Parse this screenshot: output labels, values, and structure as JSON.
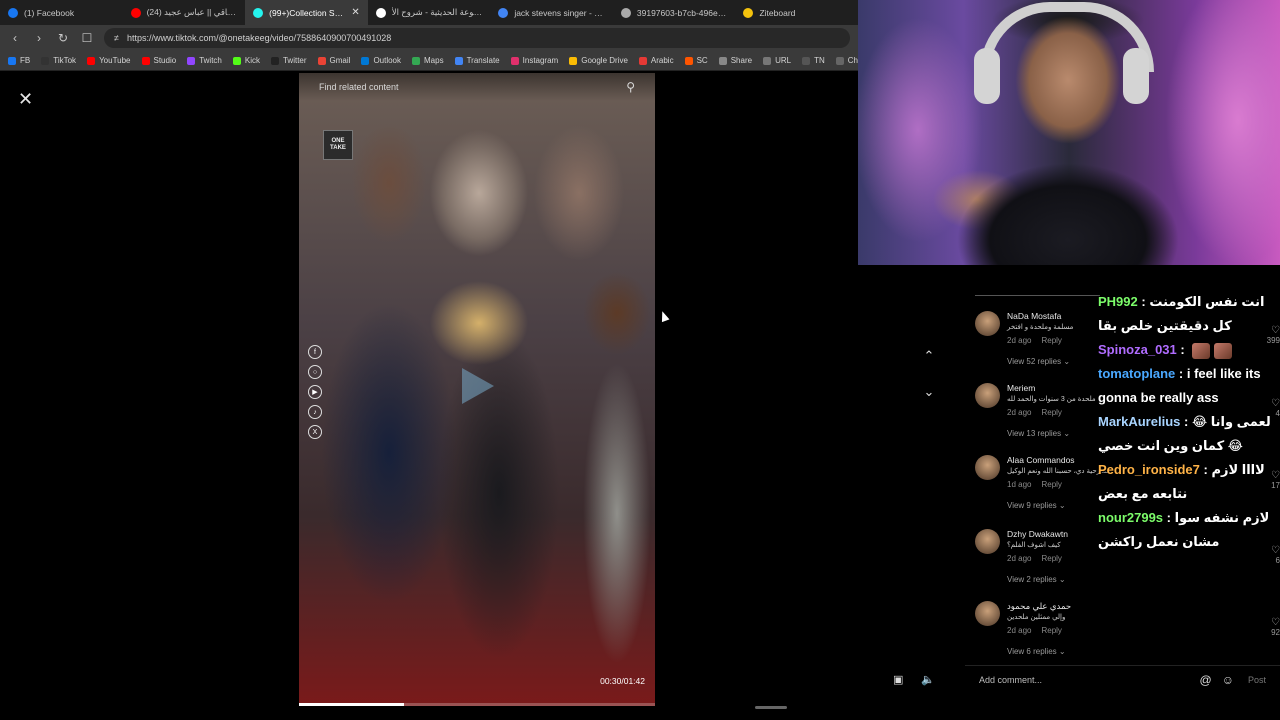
{
  "browser": {
    "tabs": [
      {
        "title": "(1) Facebook",
        "color": "#1877f2",
        "active": false
      },
      {
        "title": "(24) اجمل ساقي || عباس عجيد",
        "color": "#ff0000",
        "active": false
      },
      {
        "title": "(99+)Collection Stream",
        "color": "#25f4ee",
        "active": true
      },
      {
        "title": "الموسوعة الحديثية - شروح الأ",
        "color": "#ffffff",
        "active": false
      },
      {
        "title": "jack stevens singer - Google",
        "color": "#4285f4",
        "active": false
      },
      {
        "title": "39197603-b7cb-496e-8b98-",
        "color": "#aaaaaa",
        "active": false
      },
      {
        "title": "Ziteboard",
        "color": "#f4c20d",
        "active": false
      }
    ],
    "url": "https://www.tiktok.com/@onetakeeg/video/7588640900700491028",
    "bookmarks": [
      {
        "label": "FB",
        "color": "#1877f2"
      },
      {
        "label": "TikTok",
        "color": "#333333"
      },
      {
        "label": "YouTube",
        "color": "#ff0000"
      },
      {
        "label": "Studio",
        "color": "#ff0000"
      },
      {
        "label": "Twitch",
        "color": "#9146ff"
      },
      {
        "label": "Kick",
        "color": "#53fc18"
      },
      {
        "label": "Twitter",
        "color": "#222222"
      },
      {
        "label": "Gmail",
        "color": "#ea4335"
      },
      {
        "label": "Outlook",
        "color": "#0078d4"
      },
      {
        "label": "Maps",
        "color": "#34a853"
      },
      {
        "label": "Translate",
        "color": "#4285f4"
      },
      {
        "label": "Instagram",
        "color": "#e1306c"
      },
      {
        "label": "Google Drive",
        "color": "#fbbc04"
      },
      {
        "label": "Arabic",
        "color": "#e53935"
      },
      {
        "label": "SC",
        "color": "#ff5500"
      },
      {
        "label": "Share",
        "color": "#888888"
      },
      {
        "label": "URL",
        "color": "#777777"
      },
      {
        "label": "TN",
        "color": "#555555"
      },
      {
        "label": "Ch",
        "color": "#666666"
      }
    ]
  },
  "video": {
    "search_placeholder": "Find related content",
    "badge_text": "ONE TAKE",
    "timecode": "00:30/01:42",
    "progress_fraction": 0.294
  },
  "comments": [
    {
      "name": "NaDa Mostafa",
      "text": "مسلمة وملحدة و افتخر",
      "age": "2d ago",
      "reply": "Reply",
      "replies": "View 52 replies"
    },
    {
      "name": "Meriem",
      "text": "ملحدة من 3 سنوات والحمد لله",
      "age": "2d ago",
      "reply": "Reply",
      "replies": "View 13 replies"
    },
    {
      "name": "Alaa Commandos",
      "text": "مسرحية دي، حسبنا الله ونعم الوكيل",
      "age": "1d ago",
      "reply": "Reply",
      "replies": "View 9 replies"
    },
    {
      "name": "Dzhy Dwakawtn",
      "text": "كيف اشوف الفلم؟",
      "age": "2d ago",
      "reply": "Reply",
      "replies": "View 2 replies"
    },
    {
      "name": "حمدي علي محمود",
      "text": "وإلي ممثلين ملحدين",
      "age": "2d ago",
      "reply": "Reply",
      "replies": "View 6 replies"
    }
  ],
  "likes": [
    "399",
    "4",
    "17",
    "6",
    "92"
  ],
  "chat": [
    {
      "user": "PH992",
      "color": "#7cfc6a",
      "msg": "انت نفس الكومنت كل دقيقتين خلص بقا"
    },
    {
      "user": "Spinoza_031",
      "color": "#b06cff",
      "msg": ""
    },
    {
      "user": "tomatoplane",
      "color": "#4aa8ff",
      "msg": "i feel like its gonna be really ass"
    },
    {
      "user": "MarkAurelius",
      "color": "#a8d4ff",
      "msg": "لعمى وانا 😂😂 كمان وين انت خصي"
    },
    {
      "user": "Pedro_ironside7",
      "color": "#ffb347",
      "msg": "لاااا لازم نتابعه مع بعض"
    },
    {
      "user": "nour2799s",
      "color": "#7cfc6a",
      "msg": "لازم نشفه سوا مشان نعمل راكشن"
    }
  ],
  "comment_bar": {
    "placeholder": "Add comment...",
    "post": "Post"
  }
}
